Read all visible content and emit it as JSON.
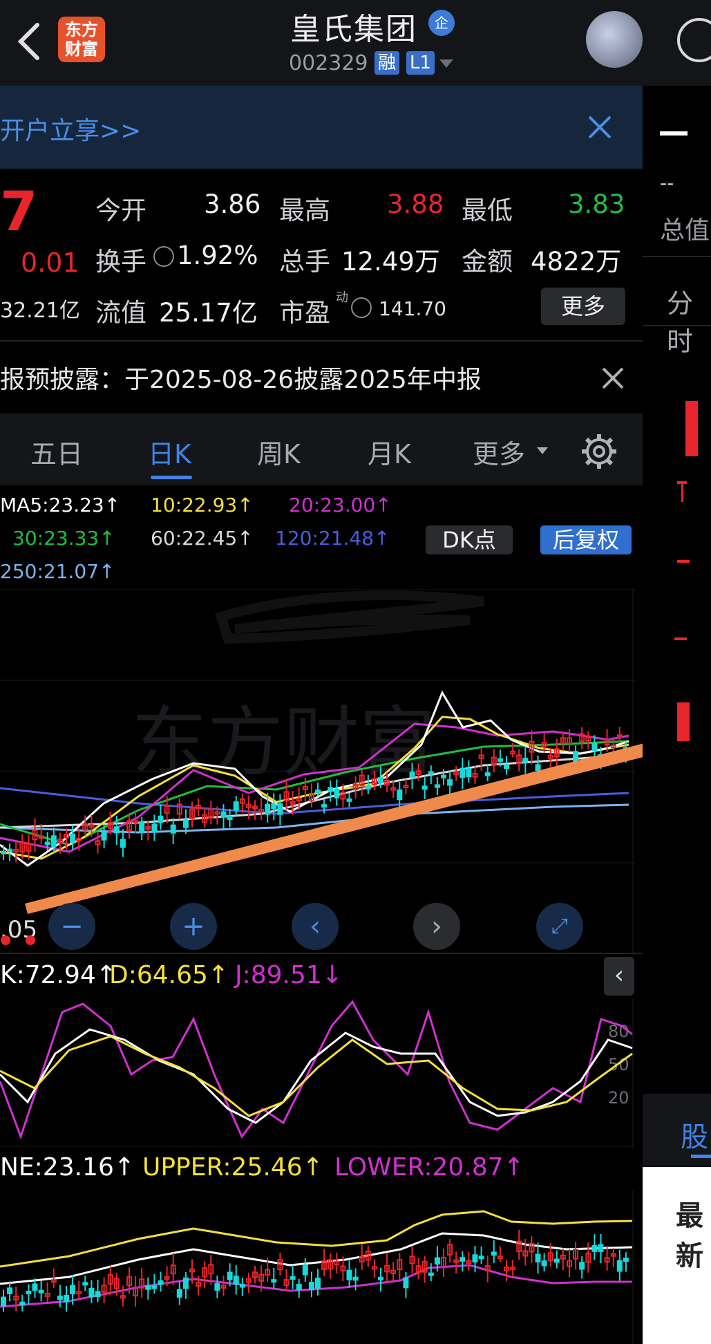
{
  "header": {
    "title": "皇氏集团",
    "qi_badge": "企",
    "code": "002329",
    "rong": "融",
    "level": "L1",
    "logo_line1": "东方",
    "logo_line2": "财富"
  },
  "banner": {
    "text": "开户立享>>"
  },
  "quote": {
    "price_fragment": "7",
    "change": "0.01",
    "mktcap": "32.21亿",
    "open_label": "今开",
    "open": "3.86",
    "high_label": "最高",
    "high": "3.88",
    "low_label": "最低",
    "low": "3.83",
    "turnover_label": "换手",
    "turnover": "1.92%",
    "volume_label": "总手",
    "volume": "12.49万",
    "amount_label": "金额",
    "amount": "4822万",
    "float_label": "流值",
    "float_cap": "25.17亿",
    "pe_label": "市盈",
    "pe_sup": "动",
    "pe": "141.70",
    "more": "更多"
  },
  "notice": {
    "text": "报预披露：于2025-08-26披露2025年中报"
  },
  "tabs": [
    "五日",
    "日K",
    "周K",
    "月K",
    "更多"
  ],
  "ma": {
    "ma5": "MA5:23.23↑",
    "ma10": "10:22.93↑",
    "ma20": "20:23.00↑",
    "ma30": "30:23.33↑",
    "ma60": "60:22.45↑",
    "ma120": "120:21.48↑",
    "ma250": "250:21.07↑",
    "dk": "DK点",
    "fuquan": "后复权"
  },
  "chart_low_label": ".05",
  "kdj": {
    "k": "K:72.94↑",
    "d": "D:64.65↑",
    "j": "J:89.51↓",
    "y80": "80",
    "y50": "50",
    "y20": "20"
  },
  "boll": {
    "mid": "NE:23.16↑",
    "upper": "UPPER:25.46↑",
    "lower": "LOWER:20.87↑"
  },
  "right": {
    "dash": "--",
    "zongzhi": "总值",
    "fenshi": "分时",
    "gu": "股",
    "zui": "最新"
  },
  "colors": {
    "up": "#e8252b",
    "down": "#16d9d9",
    "ma5": "#ffffff",
    "ma10": "#f5e03a",
    "ma20": "#d130d0",
    "ma30": "#1fbf3f",
    "ma60": "#d8d8d8",
    "ma120": "#4a5de0",
    "ma250": "#7ab4f0",
    "accent": "#3f84e8"
  }
}
